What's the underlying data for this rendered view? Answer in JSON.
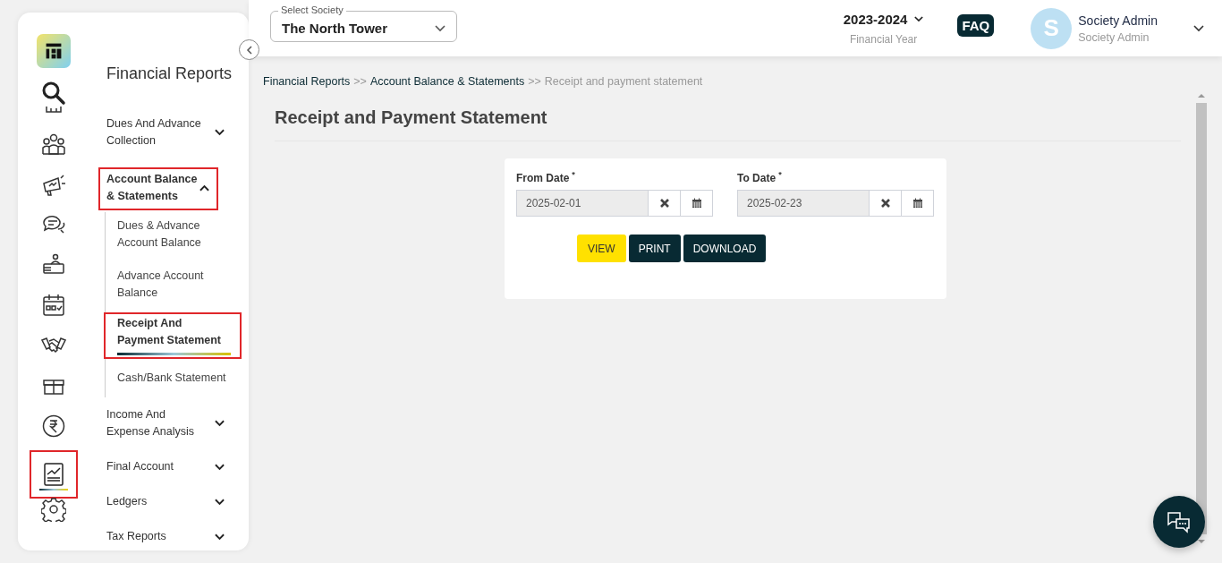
{
  "header": {
    "society_select": {
      "label": "Select Society",
      "value": "The North Tower"
    },
    "financial_year": {
      "value": "2023-2024",
      "label": "Financial Year"
    },
    "faq": "FAQ",
    "user": {
      "initial": "S",
      "name": "Society Admin",
      "role": "Society Admin"
    }
  },
  "rail": [
    {
      "kind": "search",
      "selected": false
    },
    {
      "kind": "partial",
      "selected": false
    },
    {
      "kind": "people",
      "selected": false
    },
    {
      "kind": "megaphone",
      "selected": false
    },
    {
      "kind": "chat",
      "selected": false
    },
    {
      "kind": "desk",
      "selected": false
    },
    {
      "kind": "calendar",
      "selected": false
    },
    {
      "kind": "handshake",
      "selected": false
    },
    {
      "kind": "box",
      "selected": false
    },
    {
      "kind": "rupee",
      "selected": false
    },
    {
      "kind": "report",
      "selected": true
    },
    {
      "kind": "gear",
      "selected": false
    }
  ],
  "menu": {
    "title": "Financial Reports",
    "groups": [
      {
        "label": "Dues And Advance Collection",
        "expanded": false,
        "highlighted": false
      },
      {
        "label": "Account Balance & Statements",
        "expanded": true,
        "highlighted": true,
        "children": [
          {
            "label": "Dues & Advance Account Balance",
            "selected": false
          },
          {
            "label": "Advance Account Balance",
            "selected": false
          },
          {
            "label": "Receipt And Payment Statement",
            "selected": true
          },
          {
            "label": "Cash/Bank Statement",
            "selected": false
          }
        ]
      },
      {
        "label": "Income And Expense Analysis",
        "expanded": false,
        "highlighted": false
      },
      {
        "label": "Final Account",
        "expanded": false,
        "highlighted": false
      },
      {
        "label": "Ledgers",
        "expanded": false,
        "highlighted": false
      },
      {
        "label": "Tax Reports",
        "expanded": false,
        "highlighted": false
      }
    ]
  },
  "breadcrumb": {
    "separator": ">>",
    "items": [
      {
        "label": "Financial Reports",
        "current": false
      },
      {
        "label": "Account Balance & Statements",
        "current": false
      },
      {
        "label": "Receipt and payment statement",
        "current": true
      }
    ]
  },
  "page_title": "Receipt and Payment Statement",
  "form": {
    "fields": [
      {
        "label": "From Date",
        "mark": "*",
        "value": "2025-02-01"
      },
      {
        "label": "To Date",
        "mark": "*",
        "value": "2025-02-23"
      }
    ],
    "buttons": [
      {
        "label": "VIEW",
        "kind": "primary"
      },
      {
        "label": "PRINT",
        "kind": "dark"
      },
      {
        "label": "DOWNLOAD",
        "kind": "dark"
      }
    ]
  }
}
